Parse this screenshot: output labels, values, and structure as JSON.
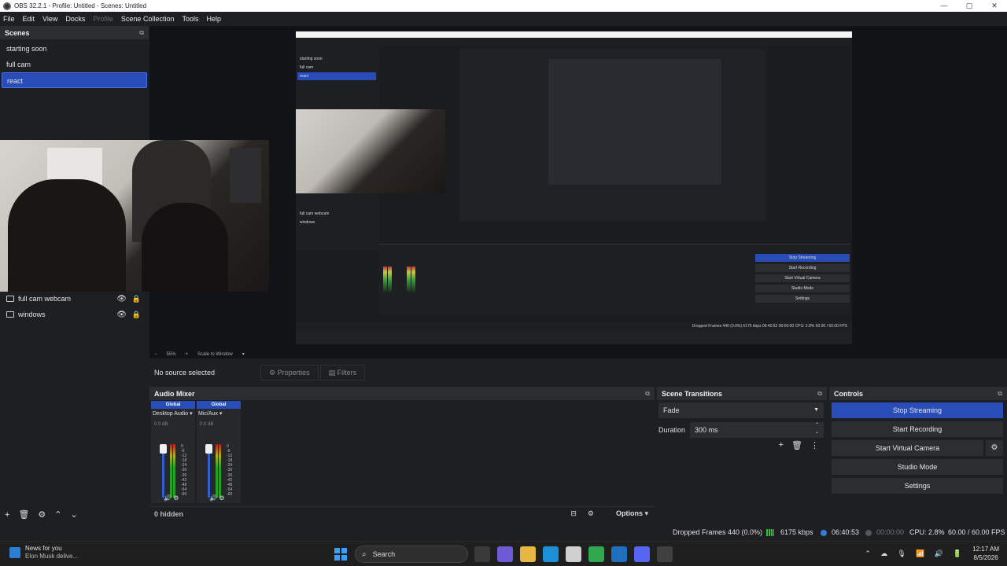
{
  "window": {
    "title": "OBS 32.2.1 - Profile: Untitled - Scenes: Untitled",
    "controls": [
      "—",
      "▢",
      "✕"
    ]
  },
  "menu": [
    "File",
    "Edit",
    "View",
    "Docks",
    "Profile",
    "Scene Collection",
    "Tools",
    "Help"
  ],
  "scenes": {
    "header": "Scenes",
    "items": [
      "starting soon",
      "full cam",
      "react"
    ],
    "active": "react"
  },
  "sources": {
    "items": [
      "full cam webcam",
      "windows"
    ]
  },
  "preview": {
    "zoom": "55%",
    "scale_mode": "Scale to Window",
    "inner": {
      "scenes": [
        "starting soon",
        "full cam",
        "react"
      ],
      "sources": [
        "full cam webcam",
        "windows"
      ],
      "status": "Dropped Frames 440 (0.0%)   6175 kbps   06:40:52   00:00:00   CPU: 2.8%   60.00 / 60.00 FPS",
      "controls": [
        "Stop Streaming",
        "Start Recording",
        "Start Virtual Camera",
        "Studio Mode",
        "Settings"
      ]
    }
  },
  "properties_bar": {
    "no_source": "No source selected",
    "properties": "Properties",
    "filters": "Filters"
  },
  "audio_mixer": {
    "header": "Audio Mixer",
    "channels": [
      {
        "global": "Global",
        "name": "Desktop Audio",
        "db": "0.0 dB"
      },
      {
        "global": "Global",
        "name": "Mic/Aux",
        "db": "0.0 dB"
      }
    ],
    "scale": [
      "0",
      "-6",
      "-12",
      "-18",
      "-24",
      "-30",
      "-36",
      "-42",
      "-48",
      "-54",
      "-60"
    ],
    "hidden": "0 hidden",
    "options": "Options"
  },
  "scene_transitions": {
    "header": "Scene Transitions",
    "transition": "Fade",
    "duration_label": "Duration",
    "duration_value": "300 ms"
  },
  "controls": {
    "header": "Controls",
    "stop_streaming": "Stop Streaming",
    "start_recording": "Start Recording",
    "start_virtual_camera": "Start Virtual Camera",
    "studio_mode": "Studio Mode",
    "settings": "Settings"
  },
  "status": {
    "dropped_frames": "Dropped Frames 440 (0.0%)",
    "bitrate": "6175 kbps",
    "stream_time": "06:40:53",
    "record_time": "00:00:00",
    "cpu": "CPU: 2.8%",
    "fps": "60.00 / 60.00 FPS"
  },
  "taskbar": {
    "news_title": "News for you",
    "news_sub": "Elon Musk delive...",
    "search": "Search",
    "time": "12:17 AM",
    "date": "8/5/2026"
  },
  "colors": {
    "accent": "#284cb8",
    "background": "#1e1f22",
    "panel": "#2b2d31"
  }
}
